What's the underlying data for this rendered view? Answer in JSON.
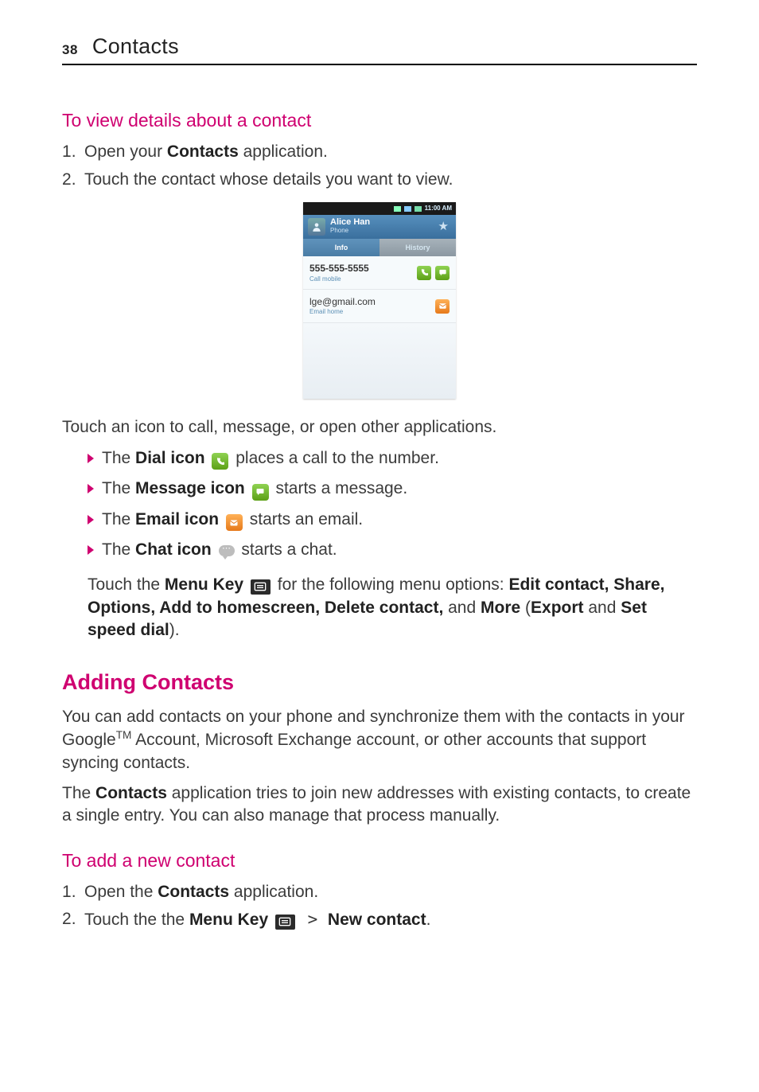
{
  "page_number": "38",
  "header_title": "Contacts",
  "sec1": {
    "heading": "To view details about a contact",
    "step1_pre": "Open your ",
    "step1_bold": "Contacts",
    "step1_post": " application.",
    "step2": "Touch the contact whose details you want to view."
  },
  "phone": {
    "time": "11:00 AM",
    "contact_name": "Alice Han",
    "contact_source": "Phone",
    "tab_info": "Info",
    "tab_history": "History",
    "phone_number": "555-555-5555",
    "phone_label": "Call mobile",
    "email": "lge@gmail.com",
    "email_label": "Email home"
  },
  "after_phone_para": "Touch an icon to call, message, or open other applications.",
  "bullets": {
    "dial_pre": "The ",
    "dial_bold": "Dial icon",
    "dial_post": " places a call to the number.",
    "msg_pre": "The ",
    "msg_bold": "Message icon",
    "msg_post": " starts a message.",
    "email_pre": "The ",
    "email_bold": "Email icon",
    "email_post": " starts an email.",
    "chat_pre": "The ",
    "chat_bold": "Chat icon",
    "chat_post": " starts a chat."
  },
  "menu_para": {
    "p1": "Touch the ",
    "menu_key": "Menu Key",
    "p2": " for the following menu options: ",
    "opts1": "Edit contact, Share, Options, Add to homescreen, Delete contact,",
    "and": " and ",
    "more": "More",
    "paren_pre": " (",
    "export": "Export",
    "and2": " and ",
    "ssd": "Set speed dial",
    "paren_post": ")."
  },
  "sec2": {
    "heading": "Adding Contacts",
    "para1a": "You can add contacts on your phone and synchronize them with the contacts in your Google",
    "tm": "TM",
    "para1b": " Account, Microsoft Exchange account, or other accounts that support syncing contacts.",
    "para2_pre": "The ",
    "para2_bold": "Contacts",
    "para2_post": " application tries to join new addresses with existing contacts, to create a single entry. You can also manage that process manually."
  },
  "sec3": {
    "heading": "To add a new contact",
    "step1_pre": "Open the ",
    "step1_bold": "Contacts",
    "step1_post": " application.",
    "step2_pre": "Touch the the ",
    "step2_bold": "Menu Key",
    "step2_gt": " > ",
    "step2_bold2": "New contact",
    "step2_post": "."
  }
}
